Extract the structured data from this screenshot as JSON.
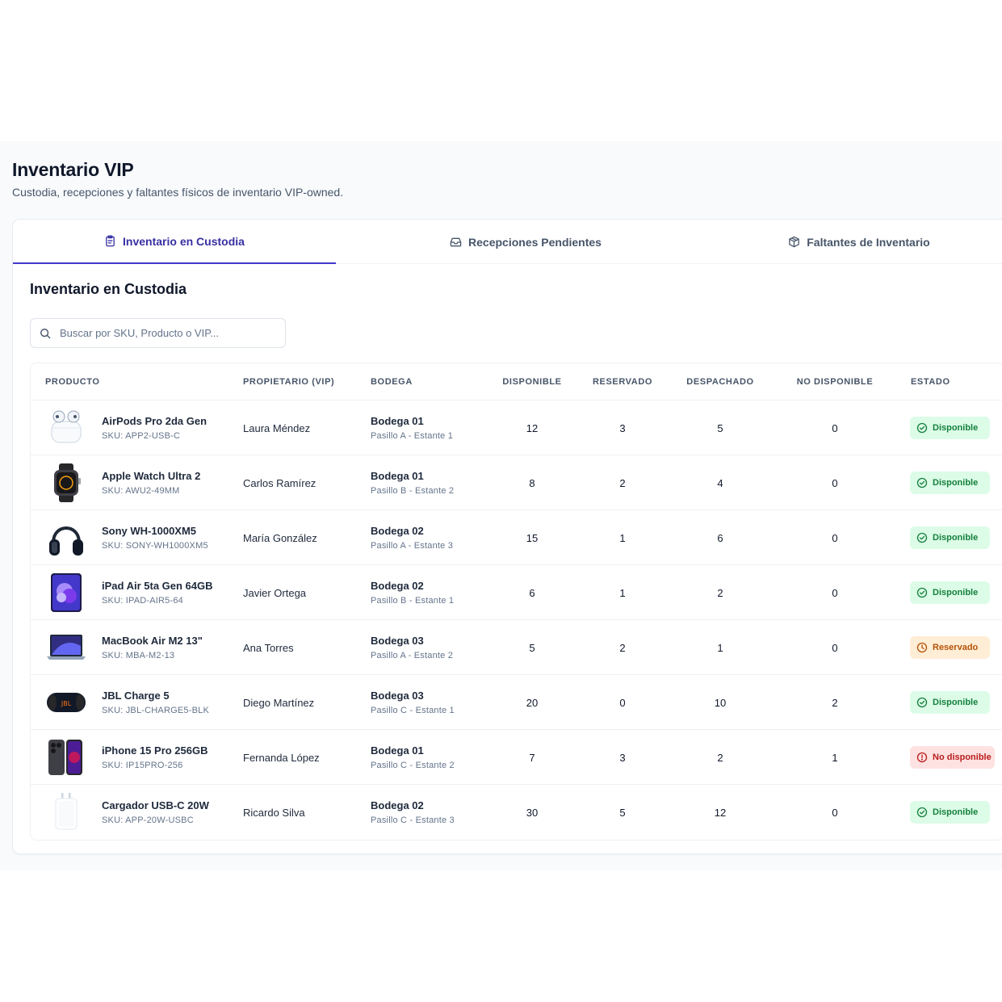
{
  "header": {
    "title": "Inventario VIP",
    "subtitle": "Custodia, recepciones y faltantes físicos de inventario VIP-owned."
  },
  "tabs": [
    {
      "label": "Inventario en Custodia",
      "icon": "clipboard-icon",
      "active": true
    },
    {
      "label": "Recepciones Pendientes",
      "icon": "inbox-icon",
      "active": false
    },
    {
      "label": "Faltantes de Inventario",
      "icon": "package-icon",
      "active": false
    }
  ],
  "section": {
    "title": "Inventario en Custodia",
    "search_placeholder": "Buscar por SKU, Producto o VIP..."
  },
  "table": {
    "columns": [
      "PRODUCTO",
      "PROPIETARIO (VIP)",
      "BODEGA",
      "DISPONIBLE",
      "RESERVADO",
      "DESPACHADO",
      "NO DISPONIBLE",
      "ESTADO"
    ],
    "rows": [
      {
        "product": "AirPods Pro 2da Gen",
        "sku": "SKU: APP2-USB-C",
        "thumb": "airpods",
        "owner": "Laura Méndez",
        "warehouse": "Bodega 01",
        "location": "Pasillo A - Estante 1",
        "available": "12",
        "reserved": "3",
        "dispatched": "5",
        "unavailable": "0",
        "status": "Disponible",
        "status_type": "ok"
      },
      {
        "product": "Apple Watch Ultra 2",
        "sku": "SKU: AWU2-49MM",
        "thumb": "watch",
        "owner": "Carlos Ramírez",
        "warehouse": "Bodega 01",
        "location": "Pasillo B - Estante 2",
        "available": "8",
        "reserved": "2",
        "dispatched": "4",
        "unavailable": "0",
        "status": "Disponible",
        "status_type": "ok"
      },
      {
        "product": "Sony WH-1000XM5",
        "sku": "SKU: SONY-WH1000XM5",
        "thumb": "headphones",
        "owner": "María González",
        "warehouse": "Bodega 02",
        "location": "Pasillo A - Estante 3",
        "available": "15",
        "reserved": "1",
        "dispatched": "6",
        "unavailable": "0",
        "status": "Disponible",
        "status_type": "ok"
      },
      {
        "product": "iPad Air 5ta Gen 64GB",
        "sku": "SKU: IPAD-AIR5-64",
        "thumb": "ipad",
        "owner": "Javier Ortega",
        "warehouse": "Bodega 02",
        "location": "Pasillo B - Estante 1",
        "available": "6",
        "reserved": "1",
        "dispatched": "2",
        "unavailable": "0",
        "status": "Disponible",
        "status_type": "ok"
      },
      {
        "product": "MacBook Air M2 13\"",
        "sku": "SKU: MBA-M2-13",
        "thumb": "macbook",
        "owner": "Ana Torres",
        "warehouse": "Bodega 03",
        "location": "Pasillo A - Estante 2",
        "available": "5",
        "reserved": "2",
        "dispatched": "1",
        "unavailable": "0",
        "status": "Reservado",
        "status_type": "res"
      },
      {
        "product": "JBL Charge 5",
        "sku": "SKU: JBL-CHARGE5-BLK",
        "thumb": "speaker",
        "owner": "Diego Martínez",
        "warehouse": "Bodega 03",
        "location": "Pasillo C - Estante 1",
        "available": "20",
        "reserved": "0",
        "dispatched": "10",
        "unavailable": "2",
        "status": "Disponible",
        "status_type": "ok"
      },
      {
        "product": "iPhone 15 Pro 256GB",
        "sku": "SKU: IP15PRO-256",
        "thumb": "iphone",
        "owner": "Fernanda López",
        "warehouse": "Bodega 01",
        "location": "Pasillo C - Estante 2",
        "available": "7",
        "reserved": "3",
        "dispatched": "2",
        "unavailable": "1",
        "status": "No disponible",
        "status_type": "no"
      },
      {
        "product": "Cargador USB-C 20W",
        "sku": "SKU: APP-20W-USBC",
        "thumb": "charger",
        "owner": "Ricardo Silva",
        "warehouse": "Bodega 02",
        "location": "Pasillo C - Estante 3",
        "available": "30",
        "reserved": "5",
        "dispatched": "12",
        "unavailable": "0",
        "status": "Disponible",
        "status_type": "ok"
      }
    ]
  },
  "colors": {
    "accent": "#4338ca",
    "ok_bg": "#dcfce7",
    "ok_fg": "#15803d",
    "reserved_bg": "#ffedd5",
    "reserved_fg": "#b45309",
    "unavailable_bg": "#fee2e2",
    "unavailable_fg": "#b91c1c"
  }
}
